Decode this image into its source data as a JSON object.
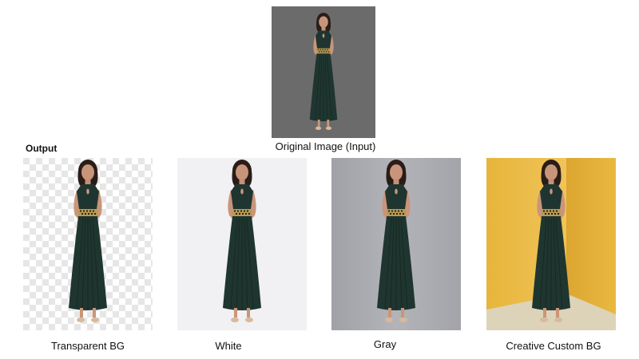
{
  "input": {
    "caption": "Original Image (Input)",
    "background": "gray-studio-background"
  },
  "output": {
    "section_label": "Output",
    "variants": [
      {
        "caption": "Transparent BG",
        "background": "checkerboard-transparent"
      },
      {
        "caption": "White",
        "background": "white"
      },
      {
        "caption": "Gray",
        "background": "light-gray"
      },
      {
        "caption": "Creative Custom BG",
        "background": "yellow-room"
      }
    ]
  },
  "colors": {
    "input_bg": "#6b6b6b",
    "white_bg": "#f1f0f2",
    "gray_bg": "#a7a8ad",
    "yellow_bg": "#e7b738",
    "dress": "#1f3530",
    "belt": "#b89a52",
    "skin": "#c9957a",
    "hair": "#2a1d18"
  }
}
